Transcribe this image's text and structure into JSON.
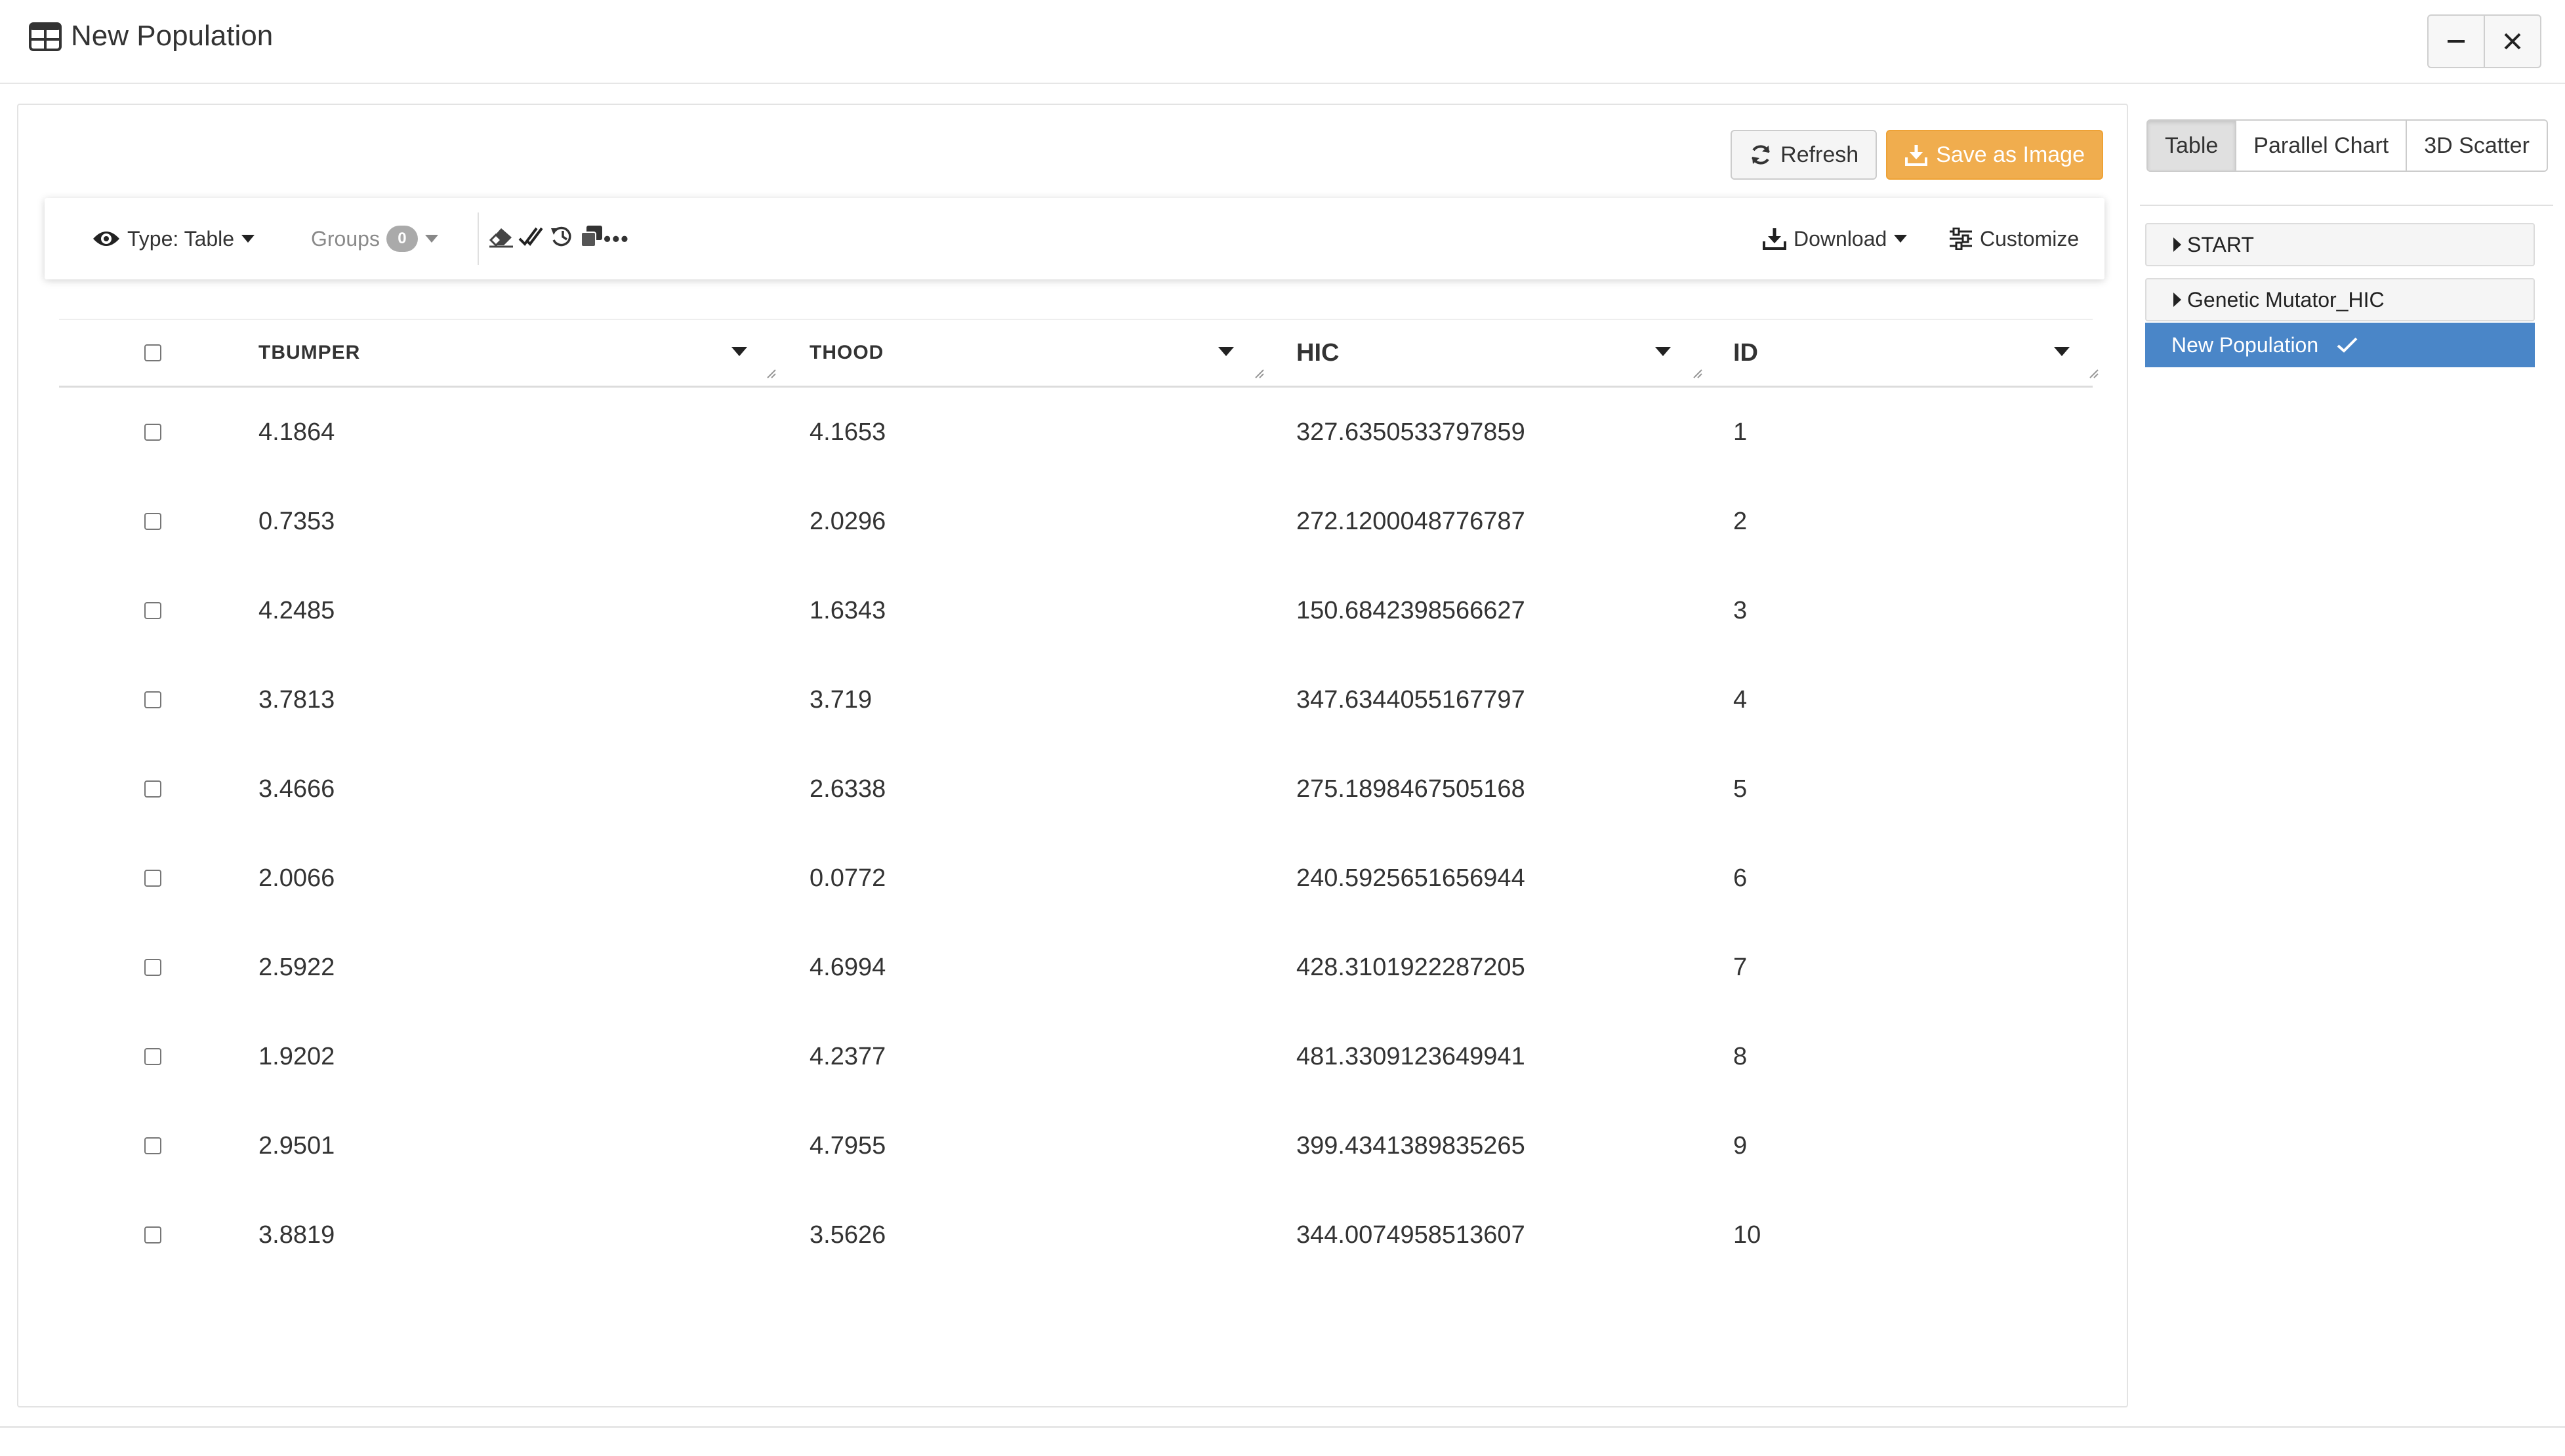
{
  "window": {
    "title": "New Population",
    "icons": {
      "app": "table-icon",
      "minimize": "minimize-icon",
      "close": "close-icon"
    }
  },
  "actions": {
    "refresh_label": "Refresh",
    "save_image_label": "Save as Image"
  },
  "toolbar": {
    "type_label": "Type: Table",
    "groups_label": "Groups",
    "groups_count": "0",
    "download_label": "Download",
    "customize_label": "Customize",
    "more_label": "•••"
  },
  "table": {
    "columns": [
      "TBUMPER",
      "THOOD",
      "HIC",
      "ID"
    ],
    "rows": [
      [
        "4.1864",
        "4.1653",
        "327.6350533797859",
        "1"
      ],
      [
        "0.7353",
        "2.0296",
        "272.1200048776787",
        "2"
      ],
      [
        "4.2485",
        "1.6343",
        "150.6842398566627",
        "3"
      ],
      [
        "3.7813",
        "3.719",
        "347.6344055167797",
        "4"
      ],
      [
        "3.4666",
        "2.6338",
        "275.1898467505168",
        "5"
      ],
      [
        "2.0066",
        "0.0772",
        "240.5925651656944",
        "6"
      ],
      [
        "2.5922",
        "4.6994",
        "428.3101922287205",
        "7"
      ],
      [
        "1.9202",
        "4.2377",
        "481.3309123649941",
        "8"
      ],
      [
        "2.9501",
        "4.7955",
        "399.4341389835265",
        "9"
      ],
      [
        "3.8819",
        "3.5626",
        "344.0074958513607",
        "10"
      ]
    ]
  },
  "view_tabs": [
    {
      "label": "Table",
      "active": true
    },
    {
      "label": "Parallel Chart",
      "active": false
    },
    {
      "label": "3D Scatter",
      "active": false
    }
  ],
  "tree": {
    "items": [
      "START",
      "Genetic Mutator_HIC"
    ],
    "active": "New Population"
  },
  "colors": {
    "accent_orange": "#f0ad4e",
    "selected_blue": "#4a86c8"
  }
}
